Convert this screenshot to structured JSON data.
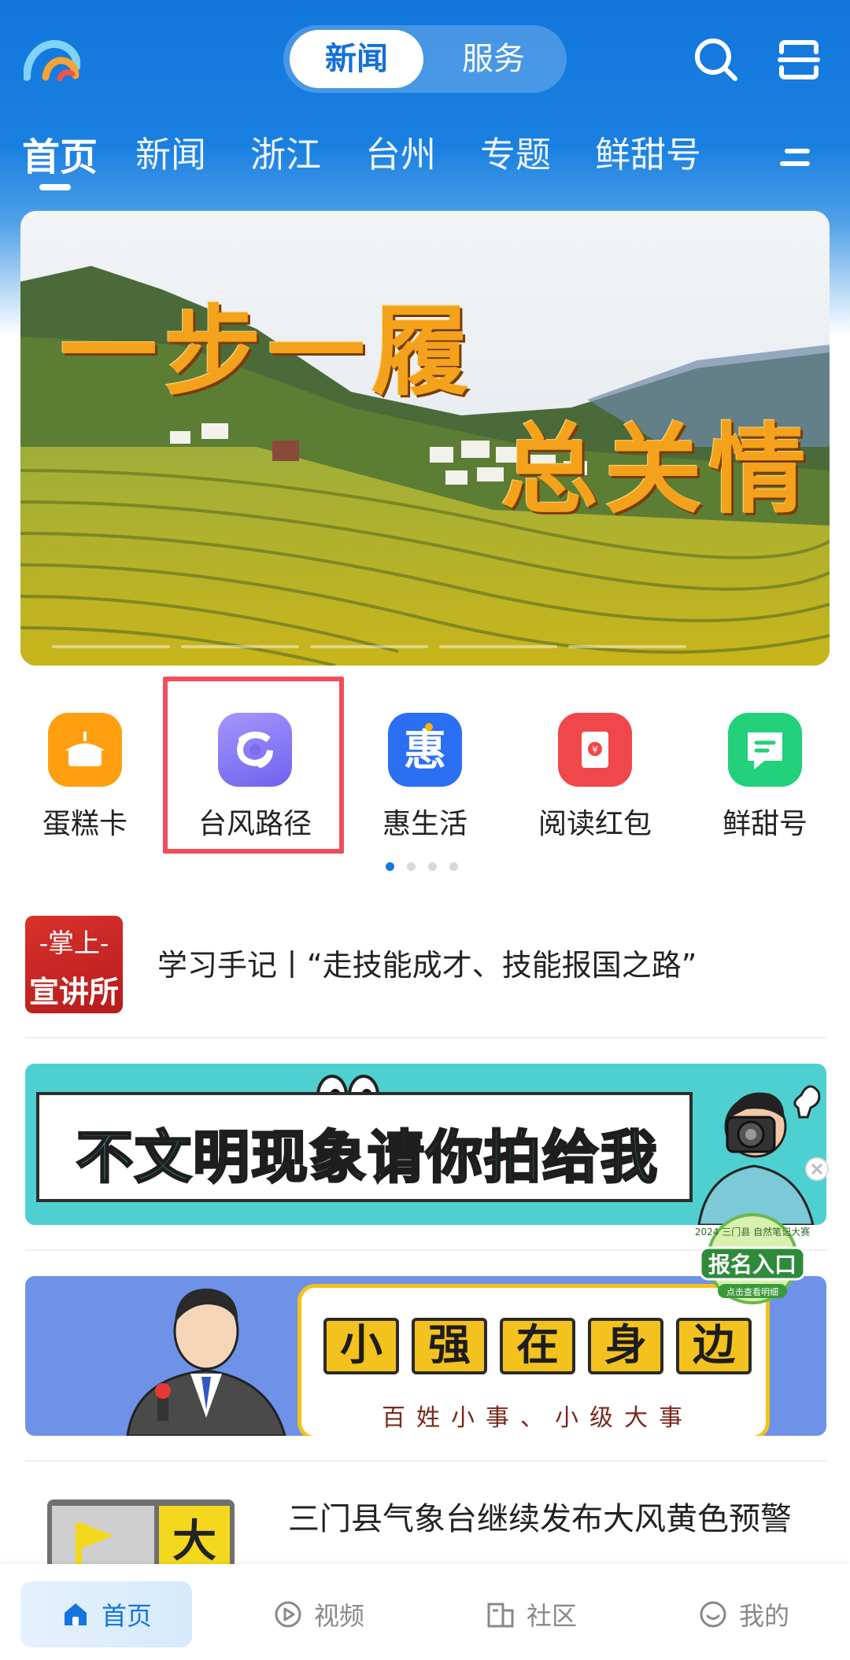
{
  "header": {
    "segment": {
      "active": "新闻",
      "inactive": "服务"
    },
    "categories": [
      "首页",
      "新闻",
      "浙江",
      "台州",
      "专题",
      "鲜甜号"
    ],
    "active_category_index": 0
  },
  "banner": {
    "title_line1": "一步一履",
    "title_line2": "总关情",
    "slide_count": 5
  },
  "quick_icons": [
    {
      "label": "蛋糕卡",
      "icon": "cake-icon",
      "color": "#ff9f0f"
    },
    {
      "label": "台风路径",
      "icon": "typhoon-icon",
      "color": "#8b7cf6"
    },
    {
      "label": "惠生活",
      "icon": "hui-icon",
      "color": "#2b6ff2"
    },
    {
      "label": "阅读红包",
      "icon": "red-envelope-icon",
      "color": "#f0474b"
    },
    {
      "label": "鲜甜号",
      "icon": "message-icon",
      "color": "#22d17a"
    }
  ],
  "quick_pager": {
    "pages": 4,
    "current": 1
  },
  "feed": {
    "news1": {
      "thumb_line1": "-掌上-",
      "thumb_line2": "宣讲所",
      "title": "学习手记丨“走技能成才、技能报国之路”"
    },
    "ad1": {
      "text": "不文明现象请你拍给我"
    },
    "ad2": {
      "words": [
        "小",
        "强",
        "在",
        "身",
        "边"
      ],
      "sub": "百姓小事、小级大事"
    },
    "news2": {
      "title": "三门县气象台继续发布大风黄色预警",
      "thumb_text": "大"
    },
    "floating_badge": {
      "label": "报名入口",
      "top_text": "2024 三门县 自然笔记大赛",
      "sub": "点击查看明细"
    }
  },
  "bottom_nav": [
    {
      "label": "首页",
      "icon": "home-icon"
    },
    {
      "label": "视频",
      "icon": "play-icon"
    },
    {
      "label": "社区",
      "icon": "community-icon"
    },
    {
      "label": "我的",
      "icon": "smile-icon"
    }
  ],
  "colors": {
    "brand_blue": "#1276dc",
    "highlight_red": "#f04e5a",
    "active_nav": "#1575e0"
  }
}
